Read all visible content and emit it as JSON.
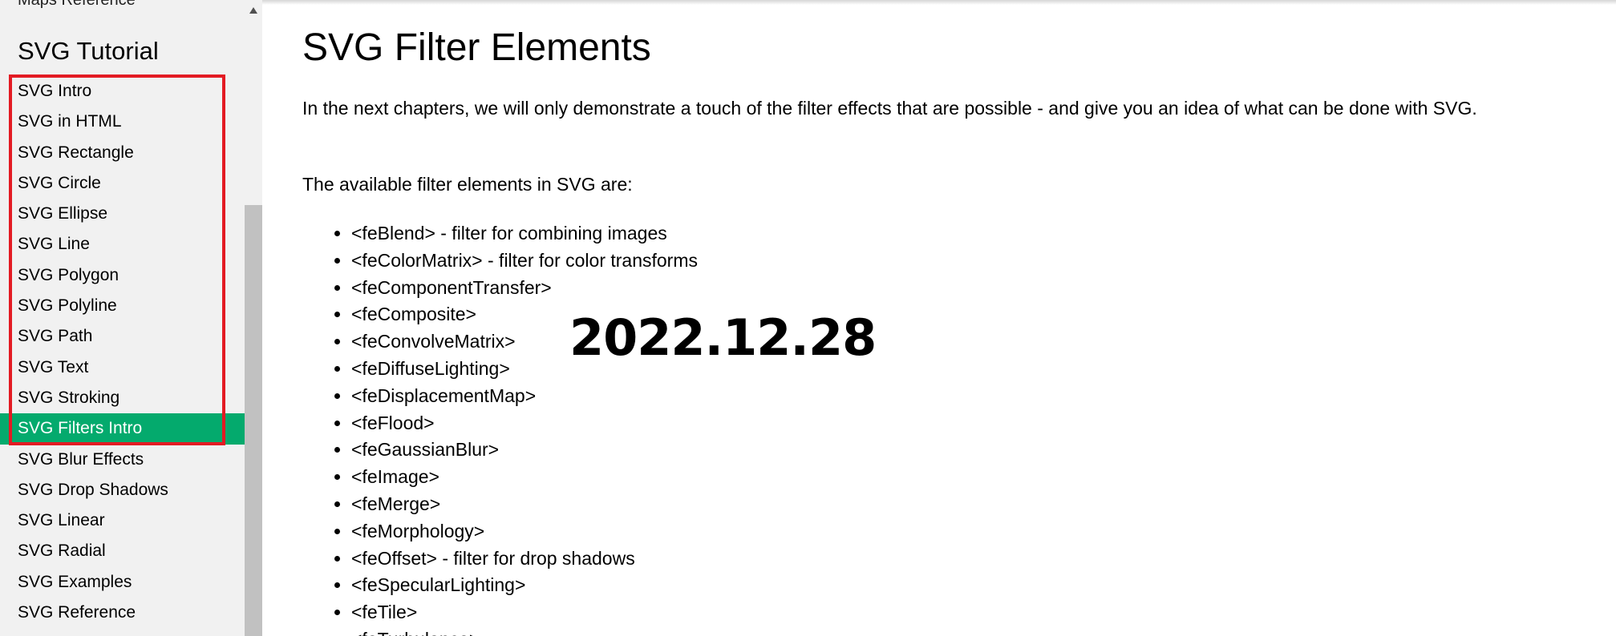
{
  "sidebar": {
    "cut_off_item": "Maps Reference",
    "heading": "SVG Tutorial",
    "items": [
      {
        "label": "SVG Intro",
        "active": false
      },
      {
        "label": "SVG in HTML",
        "active": false
      },
      {
        "label": "SVG Rectangle",
        "active": false
      },
      {
        "label": "SVG Circle",
        "active": false
      },
      {
        "label": "SVG Ellipse",
        "active": false
      },
      {
        "label": "SVG Line",
        "active": false
      },
      {
        "label": "SVG Polygon",
        "active": false
      },
      {
        "label": "SVG Polyline",
        "active": false
      },
      {
        "label": "SVG Path",
        "active": false
      },
      {
        "label": "SVG Text",
        "active": false
      },
      {
        "label": "SVG Stroking",
        "active": false
      },
      {
        "label": "SVG Filters Intro",
        "active": true
      },
      {
        "label": "SVG Blur Effects",
        "active": false
      },
      {
        "label": "SVG Drop Shadows",
        "active": false
      },
      {
        "label": "SVG Linear",
        "active": false
      },
      {
        "label": "SVG Radial",
        "active": false
      },
      {
        "label": "SVG Examples",
        "active": false
      },
      {
        "label": "SVG Reference",
        "active": false
      }
    ]
  },
  "main": {
    "title": "SVG Filter Elements",
    "intro": "In the next chapters, we will only demonstrate a touch of the filter effects that are possible - and give you an idea of what can be done with SVG.",
    "list_intro": "The available filter elements in SVG are:",
    "elements": [
      "<feBlend> - filter for combining images",
      "<feColorMatrix> - filter for color transforms",
      "<feComponentTransfer>",
      "<feComposite>",
      "<feConvolveMatrix>",
      "<feDiffuseLighting>",
      "<feDisplacementMap>",
      "<feFlood>",
      "<feGaussianBlur>",
      "<feImage>",
      "<feMerge>",
      "<feMorphology>",
      "<feOffset> - filter for drop shadows",
      "<feSpecularLighting>",
      "<feTile>",
      "<feTurbulence>"
    ]
  },
  "overlay": {
    "date": "2022.12.28"
  },
  "colors": {
    "active_nav": "#04aa6d",
    "highlight_border": "#e31b23",
    "sidebar_bg": "#f1f1f1"
  }
}
